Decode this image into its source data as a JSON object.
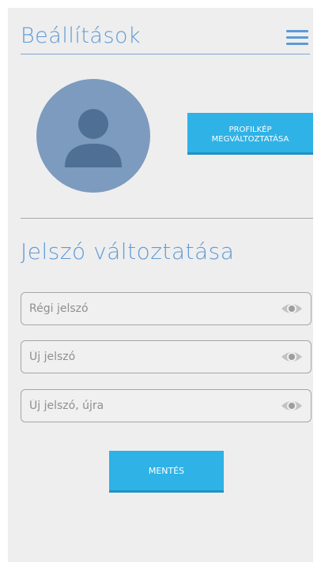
{
  "header": {
    "title": "Beállítások",
    "menu_icon": "hamburger-menu-icon"
  },
  "profile": {
    "avatar_icon": "user-silhouette-icon",
    "change_picture_label": "PROFILKÉP MEGVÁLTOZTATÁSA"
  },
  "password": {
    "section_title": "Jelszó változtatása",
    "fields": [
      {
        "placeholder": "Régi jelszó",
        "value": "",
        "icon": "eye-icon"
      },
      {
        "placeholder": "Új jelszó",
        "value": "",
        "icon": "eye-icon"
      },
      {
        "placeholder": "Új jelszó, újra",
        "value": "",
        "icon": "eye-icon"
      }
    ],
    "save_label": "MENTÉS"
  },
  "colors": {
    "accent": "#5f9ad4",
    "button": "#2fb2e6",
    "avatar": "#7d9bbe",
    "background": "#eeeeef"
  }
}
